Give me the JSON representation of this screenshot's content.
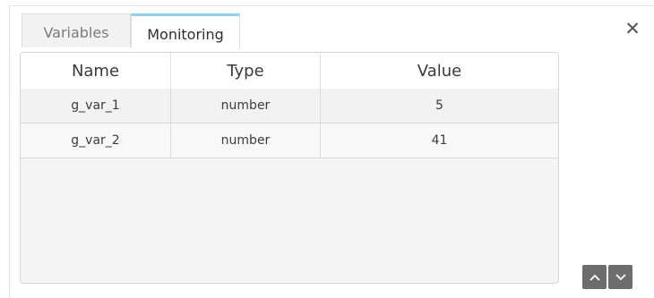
{
  "tabs": [
    {
      "label": "Variables",
      "active": false
    },
    {
      "label": "Monitoring",
      "active": true
    }
  ],
  "table": {
    "columns": [
      "Name",
      "Type",
      "Value"
    ],
    "rows": [
      {
        "name": "g_var_1",
        "type": "number",
        "value": "5"
      },
      {
        "name": "g_var_2",
        "type": "number",
        "value": "41"
      }
    ]
  },
  "icons": {
    "close": "close-icon",
    "scroll_up": "chevron-up-icon",
    "scroll_down": "chevron-down-icon"
  },
  "colors": {
    "active_tab_accent": "#8fd0ee",
    "nav_button": "#6d6d6d"
  }
}
